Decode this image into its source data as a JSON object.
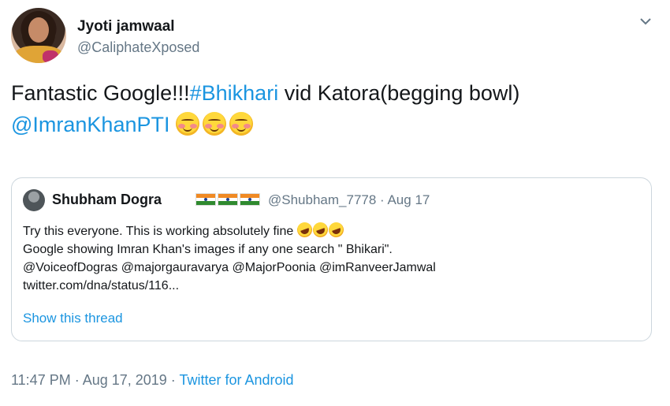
{
  "tweet": {
    "display_name": "Jyoti jamwaal",
    "handle": "@CaliphateXposed",
    "text_plain": "Fantastic Google!!!",
    "hashtag": "#Bhikhari",
    "text_after_hashtag": " vid Katora(begging bowl)",
    "mention": "@ImranKhanPTI",
    "emoji_name": "smiling-face-with-blush-icon",
    "caret_icon": "chevron-down-icon"
  },
  "quoted_tweet": {
    "display_name": "Shubham Dogra",
    "flag_icon": "india-flag-icon",
    "handle_date": "@Shubham_7778 · Aug 17",
    "line1": "Try this everyone. This is working absolutely fine",
    "line1_emoji": "rolling-on-floor-laughing-icon",
    "line2": "Google showing Imran Khan's images if any one search \" Bhikari\".",
    "line3": "@VoiceofDogras @majorgauravarya @MajorPoonia @imRanveerJamwal",
    "line4": "twitter.com/dna/status/116...",
    "show_thread": "Show this thread"
  },
  "footer": {
    "timestamp": "11:47 PM · Aug 17, 2019 · ",
    "source": "Twitter for Android"
  },
  "colors": {
    "link": "#1b95e0",
    "muted": "#657786",
    "border": "#ccd6dd"
  }
}
